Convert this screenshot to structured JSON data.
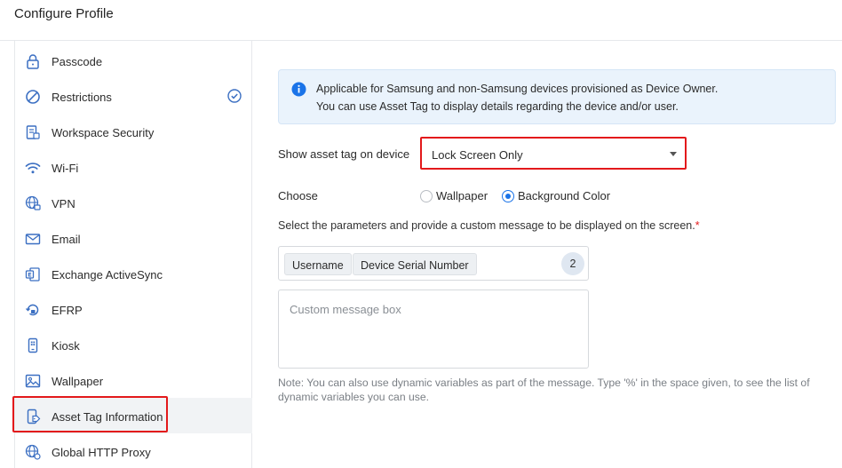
{
  "header": {
    "title": "Configure Profile"
  },
  "sidebar": {
    "items": [
      {
        "label": "Passcode",
        "icon": "lock-icon",
        "configured": false,
        "active": false
      },
      {
        "label": "Restrictions",
        "icon": "restriction-icon",
        "configured": true,
        "active": false
      },
      {
        "label": "Workspace Security",
        "icon": "workspace-security-icon",
        "configured": false,
        "active": false
      },
      {
        "label": "Wi-Fi",
        "icon": "wifi-icon",
        "configured": false,
        "active": false
      },
      {
        "label": "VPN",
        "icon": "vpn-globe-icon",
        "configured": false,
        "active": false
      },
      {
        "label": "Email",
        "icon": "mail-icon",
        "configured": false,
        "active": false
      },
      {
        "label": "Exchange ActiveSync",
        "icon": "exchange-icon",
        "configured": false,
        "active": false
      },
      {
        "label": "EFRP",
        "icon": "efrp-icon",
        "configured": false,
        "active": false
      },
      {
        "label": "Kiosk",
        "icon": "kiosk-icon",
        "configured": false,
        "active": false
      },
      {
        "label": "Wallpaper",
        "icon": "image-icon",
        "configured": false,
        "active": false
      },
      {
        "label": "Asset Tag Information",
        "icon": "asset-tag-icon",
        "configured": false,
        "active": true
      },
      {
        "label": "Global HTTP Proxy",
        "icon": "proxy-globe-icon",
        "configured": false,
        "active": false
      }
    ]
  },
  "main": {
    "info": {
      "icon": "info-icon",
      "line1": "Applicable for Samsung and non-Samsung devices provisioned as Device Owner.",
      "line2": "You can use Asset Tag to display details regarding the device and/or user."
    },
    "show_asset_tag": {
      "label": "Show asset tag on device",
      "value": "Lock Screen Only"
    },
    "choose": {
      "label": "Choose",
      "options": [
        {
          "label": "Wallpaper",
          "selected": false
        },
        {
          "label": "Background Color",
          "selected": true
        }
      ]
    },
    "params": {
      "description": "Select the parameters and provide a custom message to be displayed on the screen.",
      "required_mark": "*",
      "tags": [
        "Username",
        "Device Serial Number"
      ],
      "count": "2"
    },
    "message": {
      "placeholder": "Custom message box",
      "value": ""
    },
    "note": "Note: You can also use dynamic variables as part of the message. Type '%' in the space given, to see the list of dynamic variables you can use."
  },
  "colors": {
    "accent": "#1a73e8",
    "highlight": "#e3191b",
    "info_bg": "#eaf3fc"
  }
}
